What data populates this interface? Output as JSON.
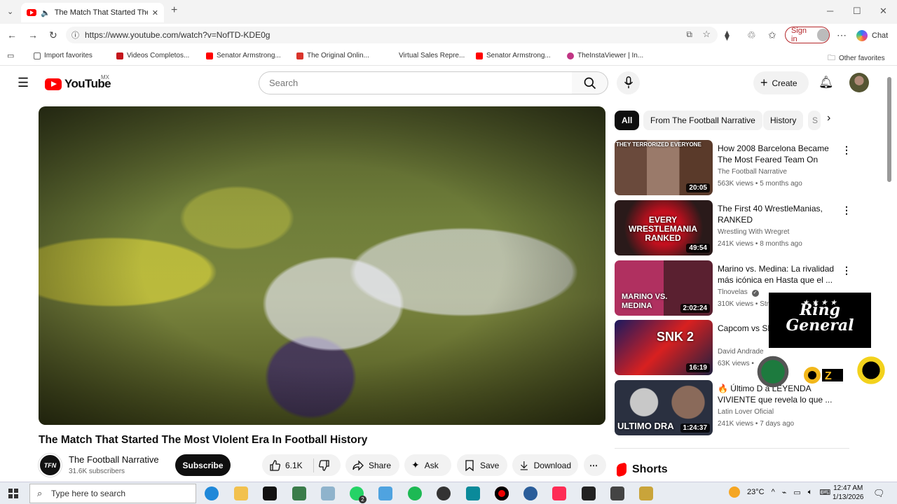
{
  "browser": {
    "tab_title": "The Match That Started The M",
    "url": "https://www.youtube.com/watch?v=NofTD-KDE0g",
    "signin_label": "Sign in",
    "chat_label": "Chat",
    "favorites": [
      {
        "label": "Import favorites",
        "color": "#666"
      },
      {
        "label": "Videos Completos...",
        "color": "#c4161c"
      },
      {
        "label": "Senator Armstrong...",
        "color": "#ff0000"
      },
      {
        "label": "The Original Onlin...",
        "color": "#d9342b"
      },
      {
        "label": "Virtual Sales Repre...",
        "color": "#ffffff"
      },
      {
        "label": "Senator Armstrong...",
        "color": "#ff0000"
      },
      {
        "label": "TheInstaViewer | In...",
        "color": "#c13584"
      }
    ],
    "other_favorites": "Other favorites"
  },
  "youtube": {
    "logo_text": "YouTube",
    "region": "MX",
    "search_placeholder": "Search",
    "create_label": "Create",
    "video_title": "The Match That Started The Most VIolent Era In Football History",
    "channel_name": "The Football Narrative",
    "channel_initials": "TFN",
    "subscribers": "31.6K subscribers",
    "subscribe_label": "Subscribe",
    "likes": "6.1K",
    "share_label": "Share",
    "ask_label": "Ask",
    "save_label": "Save",
    "download_label": "Download",
    "chips": [
      "All",
      "From The Football Narrative",
      "History",
      "S"
    ],
    "recommendations": [
      {
        "title": "How 2008 Barcelona Became The Most Feared Team On The...",
        "channel": "The Football Narrative",
        "meta": "563K views • 5 months ago",
        "duration": "20:05",
        "thumb_text": "THEY TERRORIZED EVERYONE"
      },
      {
        "title": "The First 40 WrestleManias, RANKED",
        "channel": "Wrestling With Wregret",
        "meta": "241K views • 8 months ago",
        "duration": "49:54",
        "thumb_text": "EVERY WRESTLEMANIA RANKED"
      },
      {
        "title": "Marino vs. Medina: La rivalidad más icónica en Hasta que el ...",
        "channel": "Tlnovelas",
        "meta": "310K views • Str",
        "duration": "2:02:24",
        "thumb_text": "MARINO VS. MEDINA"
      },
      {
        "title": "Capcom vs SN God - God Ru",
        "channel": "David Andrade",
        "meta": "63K views •",
        "duration": "16:19",
        "thumb_text": "SNK 2"
      },
      {
        "title": "🔥 Último D a LEYENDA VIVIENTE que revela lo que ...",
        "channel": "Latin Lover Oficial",
        "meta": "241K views • 7 days ago",
        "duration": "1:24:37",
        "thumb_text": "ULTIMO DRA"
      }
    ],
    "shorts_label": "Shorts"
  },
  "overlay": {
    "ring_general": "Ring General",
    "oz_label": "OZ"
  },
  "taskbar": {
    "search_placeholder": "Type here to search",
    "temperature": "23°C",
    "time": "12:47 AM",
    "date": "1/13/2026",
    "whatsapp_badge": "2"
  }
}
